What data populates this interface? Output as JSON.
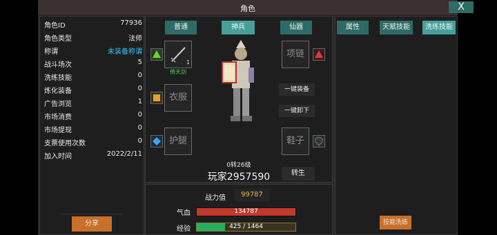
{
  "window": {
    "title": "角色",
    "close_label": "X"
  },
  "stats": [
    {
      "label": "角色ID",
      "value": "77936"
    },
    {
      "label": "角色类型",
      "value": "法师"
    },
    {
      "label": "称谓",
      "value": "未装备称谓"
    },
    {
      "label": "战斗场次",
      "value": "5"
    },
    {
      "label": "洗练技能",
      "value": "0"
    },
    {
      "label": "炼化装备",
      "value": "0"
    },
    {
      "label": "广告浏览",
      "value": "1"
    },
    {
      "label": "市场消费",
      "value": "0"
    },
    {
      "label": "市场提现",
      "value": "0"
    },
    {
      "label": "支票使用次数",
      "value": "0"
    },
    {
      "label": "加入时间",
      "value": "2022/2/11"
    }
  ],
  "share_label": "分享",
  "equip_tabs": [
    "普通",
    "神兵",
    "仙器"
  ],
  "slots": {
    "weapon_count": "1",
    "weapon_name": "倚天剑",
    "clothes": "衣服",
    "legs": "护腿",
    "necklace": "项链",
    "shoes": "鞋子"
  },
  "actions": {
    "equip_all": "一键装备",
    "unequip_all": "一键卸下",
    "rebirth": "转生"
  },
  "player": {
    "level": "0转26级",
    "name": "玩家2957590"
  },
  "combat": {
    "power_label": "战力值",
    "power_value": "99787"
  },
  "bars": {
    "hp_label": "气血",
    "hp_text": "134787",
    "hp_fraction": 1.0,
    "exp_label": "经验",
    "exp_text": "425 / 1464",
    "exp_fraction": 0.29
  },
  "right_tabs": [
    "属性",
    "天赋技能",
    "洗练技能"
  ],
  "skill_wash_label": "技能洗练",
  "colors": {
    "accent": "#2f6b66",
    "title_name": "#31c6ff",
    "power": "#e0b84a",
    "hp": "#c0392b",
    "exp": "#27ae60"
  }
}
